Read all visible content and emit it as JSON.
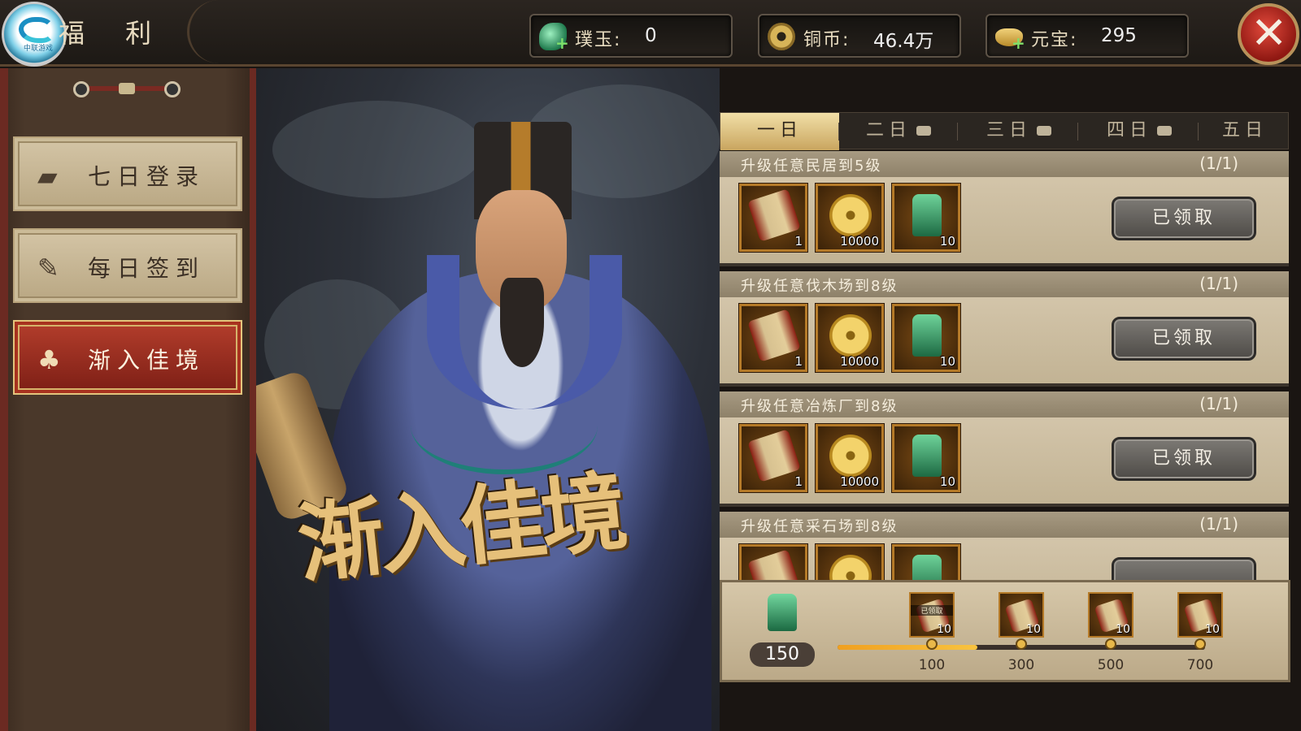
{
  "header": {
    "logo_text": "中联游戏",
    "title": "福 利",
    "resources": [
      {
        "label": "璞玉:",
        "value": "0",
        "icon": "jade-icon"
      },
      {
        "label": "铜币:",
        "value": "46.4万",
        "icon": "copper-coin-icon"
      },
      {
        "label": "元宝:",
        "value": "295",
        "icon": "gold-ingot-icon"
      }
    ],
    "close_glyph": "✕"
  },
  "sidebar": {
    "items": [
      {
        "label": "七日登录",
        "icon": "scroll-icon",
        "active": false
      },
      {
        "label": "每日签到",
        "icon": "feather-icon",
        "active": false
      },
      {
        "label": "渐入佳境",
        "icon": "bell-icon",
        "active": true
      }
    ]
  },
  "hero": {
    "title": "渐入佳境"
  },
  "tabs": {
    "days": [
      {
        "label": "一日",
        "selected": true,
        "locked": false
      },
      {
        "label": "二日",
        "selected": false,
        "locked": true
      },
      {
        "label": "三日",
        "selected": false,
        "locked": true
      },
      {
        "label": "四日",
        "selected": false,
        "locked": true
      },
      {
        "label": "五日",
        "selected": false,
        "locked": false
      }
    ]
  },
  "tasks": [
    {
      "name": "升级任意民居到5级",
      "progress": "(1/1)",
      "button": "已领取",
      "rewards": [
        {
          "icon": "decree-scroll-icon",
          "qty": "1"
        },
        {
          "icon": "gold-coin-icon",
          "qty": "10000"
        },
        {
          "icon": "jade-lantern-icon",
          "qty": "10"
        }
      ]
    },
    {
      "name": "升级任意伐木场到8级",
      "progress": "(1/1)",
      "button": "已领取",
      "rewards": [
        {
          "icon": "decree-scroll-icon",
          "qty": "1"
        },
        {
          "icon": "gold-coin-icon",
          "qty": "10000"
        },
        {
          "icon": "jade-lantern-icon",
          "qty": "10"
        }
      ]
    },
    {
      "name": "升级任意冶炼厂到8级",
      "progress": "(1/1)",
      "button": "已领取",
      "rewards": [
        {
          "icon": "decree-scroll-icon",
          "qty": "1"
        },
        {
          "icon": "gold-coin-icon",
          "qty": "10000"
        },
        {
          "icon": "jade-lantern-icon",
          "qty": "10"
        }
      ]
    },
    {
      "name": "升级任意采石场到8级",
      "progress": "(1/1)",
      "button": "",
      "rewards": [
        {
          "icon": "decree-scroll-icon",
          "qty": ""
        },
        {
          "icon": "gold-coin-icon",
          "qty": ""
        },
        {
          "icon": "jade-lantern-icon",
          "qty": ""
        }
      ]
    }
  ],
  "milestone": {
    "current": "150",
    "progress_fraction": 0.38,
    "nodes": [
      {
        "threshold": "100",
        "reward_qty": "10",
        "claimed_text": "已领取"
      },
      {
        "threshold": "300",
        "reward_qty": "10",
        "claimed_text": ""
      },
      {
        "threshold": "500",
        "reward_qty": "10",
        "claimed_text": ""
      },
      {
        "threshold": "700",
        "reward_qty": "10",
        "claimed_text": ""
      }
    ]
  },
  "colors": {
    "accent_gold": "#c9a55f",
    "active_red": "#9c2a1c",
    "progress_orange": "#f0a020"
  }
}
